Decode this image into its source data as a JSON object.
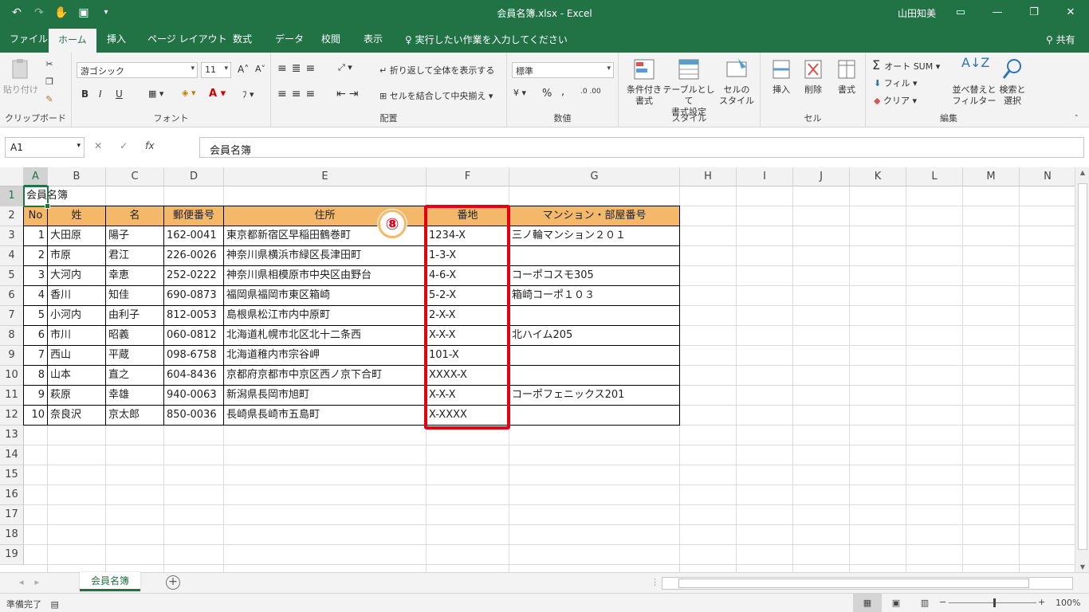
{
  "window": {
    "title": "会員名簿.xlsx  -  Excel",
    "user": "山田知美"
  },
  "tabs": [
    "ファイル",
    "ホーム",
    "挿入",
    "ページ レイアウト",
    "数式",
    "データ",
    "校閲",
    "表示"
  ],
  "tell_me": "実行したい作業を入力してください",
  "share": "共有",
  "ribbon": {
    "clipboard": {
      "paste": "貼り付け",
      "label": "クリップボード"
    },
    "font": {
      "name": "游ゴシック",
      "size": "11",
      "bold": "B",
      "italic": "I",
      "underline": "U",
      "label": "フォント"
    },
    "align": {
      "wrap": "折り返して全体を表示する",
      "merge": "セルを結合して中央揃え",
      "label": "配置"
    },
    "number": {
      "format": "標準",
      "percent": "%",
      "comma": ",",
      "label": "数値"
    },
    "styles": {
      "cond": [
        "条件付き",
        "書式"
      ],
      "table": [
        "テーブルとして",
        "書式設定"
      ],
      "cell": [
        "セルの",
        "スタイル"
      ],
      "label": "スタイル"
    },
    "cells": {
      "insert": "挿入",
      "delete": "削除",
      "format": "書式",
      "label": "セル"
    },
    "editing": {
      "autosum": "オート SUM",
      "fill": "フィル",
      "clear": "クリア",
      "sort": [
        "並べ替えと",
        "フィルター"
      ],
      "find": [
        "検索と",
        "選択"
      ],
      "label": "編集"
    }
  },
  "formula_bar": {
    "name_box": "A1",
    "fx": "fx",
    "content": "会員名簿"
  },
  "columns": [
    "A",
    "B",
    "C",
    "D",
    "E",
    "F",
    "G",
    "H",
    "I",
    "J",
    "K",
    "L",
    "M",
    "N"
  ],
  "rows": [
    "1",
    "2",
    "3",
    "4",
    "5",
    "6",
    "7",
    "8",
    "9",
    "10",
    "11",
    "12",
    "13",
    "14",
    "15",
    "16",
    "17",
    "18",
    "19"
  ],
  "sheet": {
    "title": "会員名簿",
    "headers": [
      "No",
      "姓",
      "名",
      "郵便番号",
      "住所",
      "番地",
      "マンション・部屋番号"
    ],
    "data": [
      [
        "1",
        "大田原",
        "陽子",
        "162-0041",
        "東京都新宿区早稲田鶴巻町",
        "1234-X",
        "三ノ輪マンション２０１"
      ],
      [
        "2",
        "市原",
        "君江",
        "226-0026",
        "神奈川県横浜市緑区長津田町",
        "1-3-X",
        ""
      ],
      [
        "3",
        "大河内",
        "幸恵",
        "252-0222",
        "神奈川県相模原市中央区由野台",
        "4-6-X",
        "コーポコスモ305"
      ],
      [
        "4",
        "香川",
        "知佳",
        "690-0873",
        "福岡県福岡市東区箱崎",
        "5-2-X",
        "箱崎コーポ１０３"
      ],
      [
        "5",
        "小河内",
        "由利子",
        "812-0053",
        "島根県松江市内中原町",
        "2-X-X",
        ""
      ],
      [
        "6",
        "市川",
        "昭義",
        "060-0812",
        "北海道札幌市北区北十二条西",
        "X-X-X",
        "北ハイム205"
      ],
      [
        "7",
        "西山",
        "平蔵",
        "098-6758",
        "北海道稚内市宗谷岬",
        "101-X",
        ""
      ],
      [
        "8",
        "山本",
        "直之",
        "604-8436",
        "京都府京都市中京区西ノ京下合町",
        "XXXX-X",
        ""
      ],
      [
        "9",
        "萩原",
        "幸雄",
        "940-0063",
        "新潟県長岡市旭町",
        "X-X-X",
        "コーポフェニックス201"
      ],
      [
        "10",
        "奈良沢",
        "京太郎",
        "850-0036",
        "長崎県長崎市五島町",
        "X-XXXX",
        ""
      ]
    ],
    "badge": "⑧"
  },
  "sheet_tab": "会員名簿",
  "status": {
    "ready": "準備完了",
    "zoom": "100%"
  }
}
